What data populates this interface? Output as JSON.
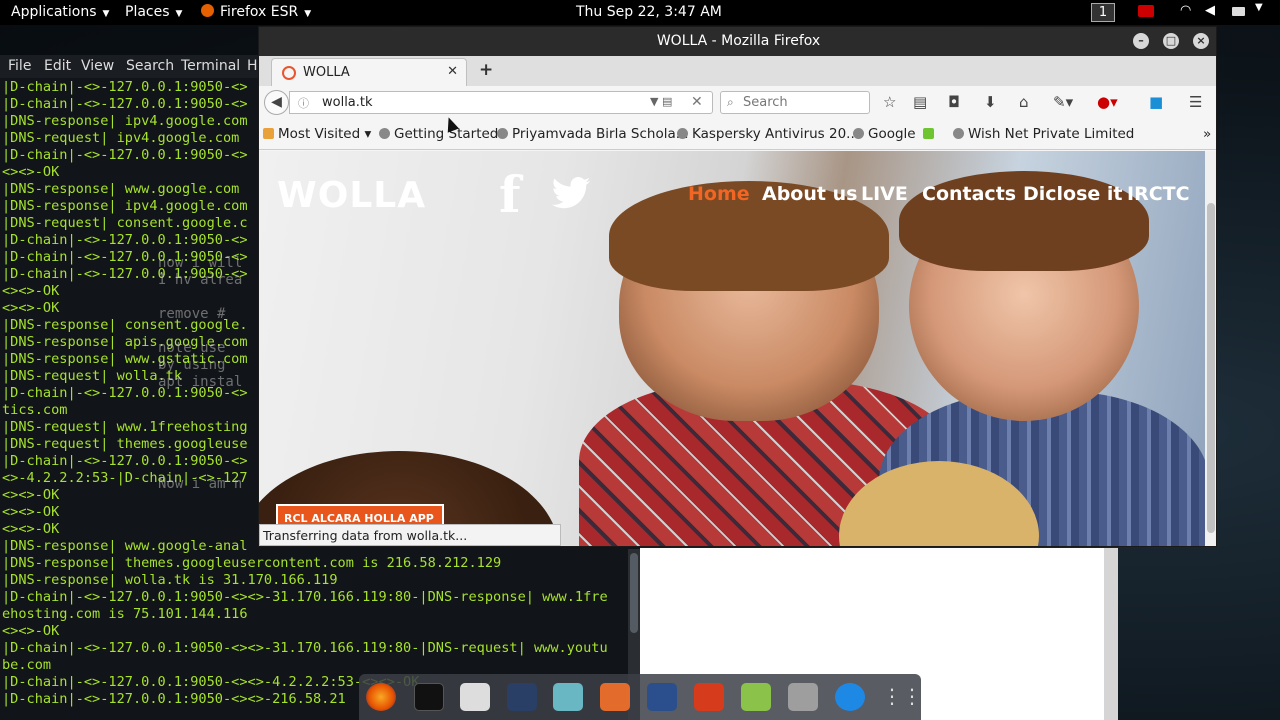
{
  "topbar": {
    "applications": "Applications",
    "places": "Places",
    "firefox": "Firefox ESR",
    "clock": "Thu Sep 22,  3:47 AM",
    "workspace": "1"
  },
  "terminal": {
    "menu": [
      "File",
      "Edit",
      "View",
      "Search",
      "Terminal",
      "H"
    ],
    "lines": [
      "|D-chain|-<>-127.0.0.1:9050-<>",
      "|D-chain|-<>-127.0.0.1:9050-<>",
      "|DNS-response| ipv4.google.com",
      "|DNS-request| ipv4.google.com",
      "|D-chain|-<>-127.0.0.1:9050-<>",
      "<><>-OK",
      "|DNS-response| www.google.com",
      "|DNS-response| ipv4.google.com",
      "|DNS-request| consent.google.c",
      "|D-chain|-<>-127.0.0.1:9050-<>",
      "|D-chain|-<>-127.0.0.1:9050-<>",
      "|D-chain|-<>-127.0.0.1:9050-<>",
      "<><>-OK",
      "<><>-OK",
      "|DNS-response| consent.google.",
      "|DNS-response| apis.google.com",
      "|DNS-response| www.gstatic.com",
      "|DNS-request| wolla.tk",
      "|D-chain|-<>-127.0.0.1:9050-<>",
      "tics.com",
      "|DNS-request| www.1freehosting",
      "|DNS-request| themes.googleuse",
      "|D-chain|-<>-127.0.0.1:9050-<>",
      "<>-4.2.2.2:53-|D-chain|-<>-127",
      "<><>-OK",
      "<><>-OK",
      "<><>-OK",
      "|DNS-response| www.google-anal",
      "|DNS-response| themes.googleusercontent.com is 216.58.212.129",
      "|DNS-response| wolla.tk is 31.170.166.119",
      "|D-chain|-<>-127.0.0.1:9050-<><>-31.170.166.119:80-|DNS-response| www.1fre",
      "ehosting.com is 75.101.144.116",
      "<><>-OK",
      "|D-chain|-<>-127.0.0.1:9050-<><>-31.170.166.119:80-|DNS-request| www.youtu",
      "be.com",
      "|D-chain|-<>-127.0.0.1:9050-<><>-4.2.2.2:53-<><>-OK",
      "|D-chain|-<>-127.0.0.1:9050-<><>-216.58.21"
    ],
    "ghost_text": "now i will\nI hv alrea\n\nremove #\n\nnote use\nby using\napt instal\n\n\n\n\n\nNow i am n"
  },
  "firefox": {
    "window_title": "WOLLA - Mozilla Firefox",
    "tab_title": "WOLLA",
    "url": "wolla.tk",
    "search_placeholder": "Search",
    "bookmarks": [
      "Most Visited",
      "Getting Started",
      "Priyamvada Birla Schola...",
      "Kaspersky Antivirus 20...",
      "Google",
      "Wish Net Private Limited"
    ],
    "status": "Transferring data from wolla.tk..."
  },
  "site": {
    "logo": "WOLLA",
    "nav": [
      "Home",
      "About us",
      "LIVE",
      "Contacts",
      "Diclose it",
      "IRCTC"
    ],
    "cta": "RCL ALCARA HOLLA APP"
  },
  "colors": {
    "accent_orange": "#f26522",
    "terminal_green": "#a6e22e"
  }
}
